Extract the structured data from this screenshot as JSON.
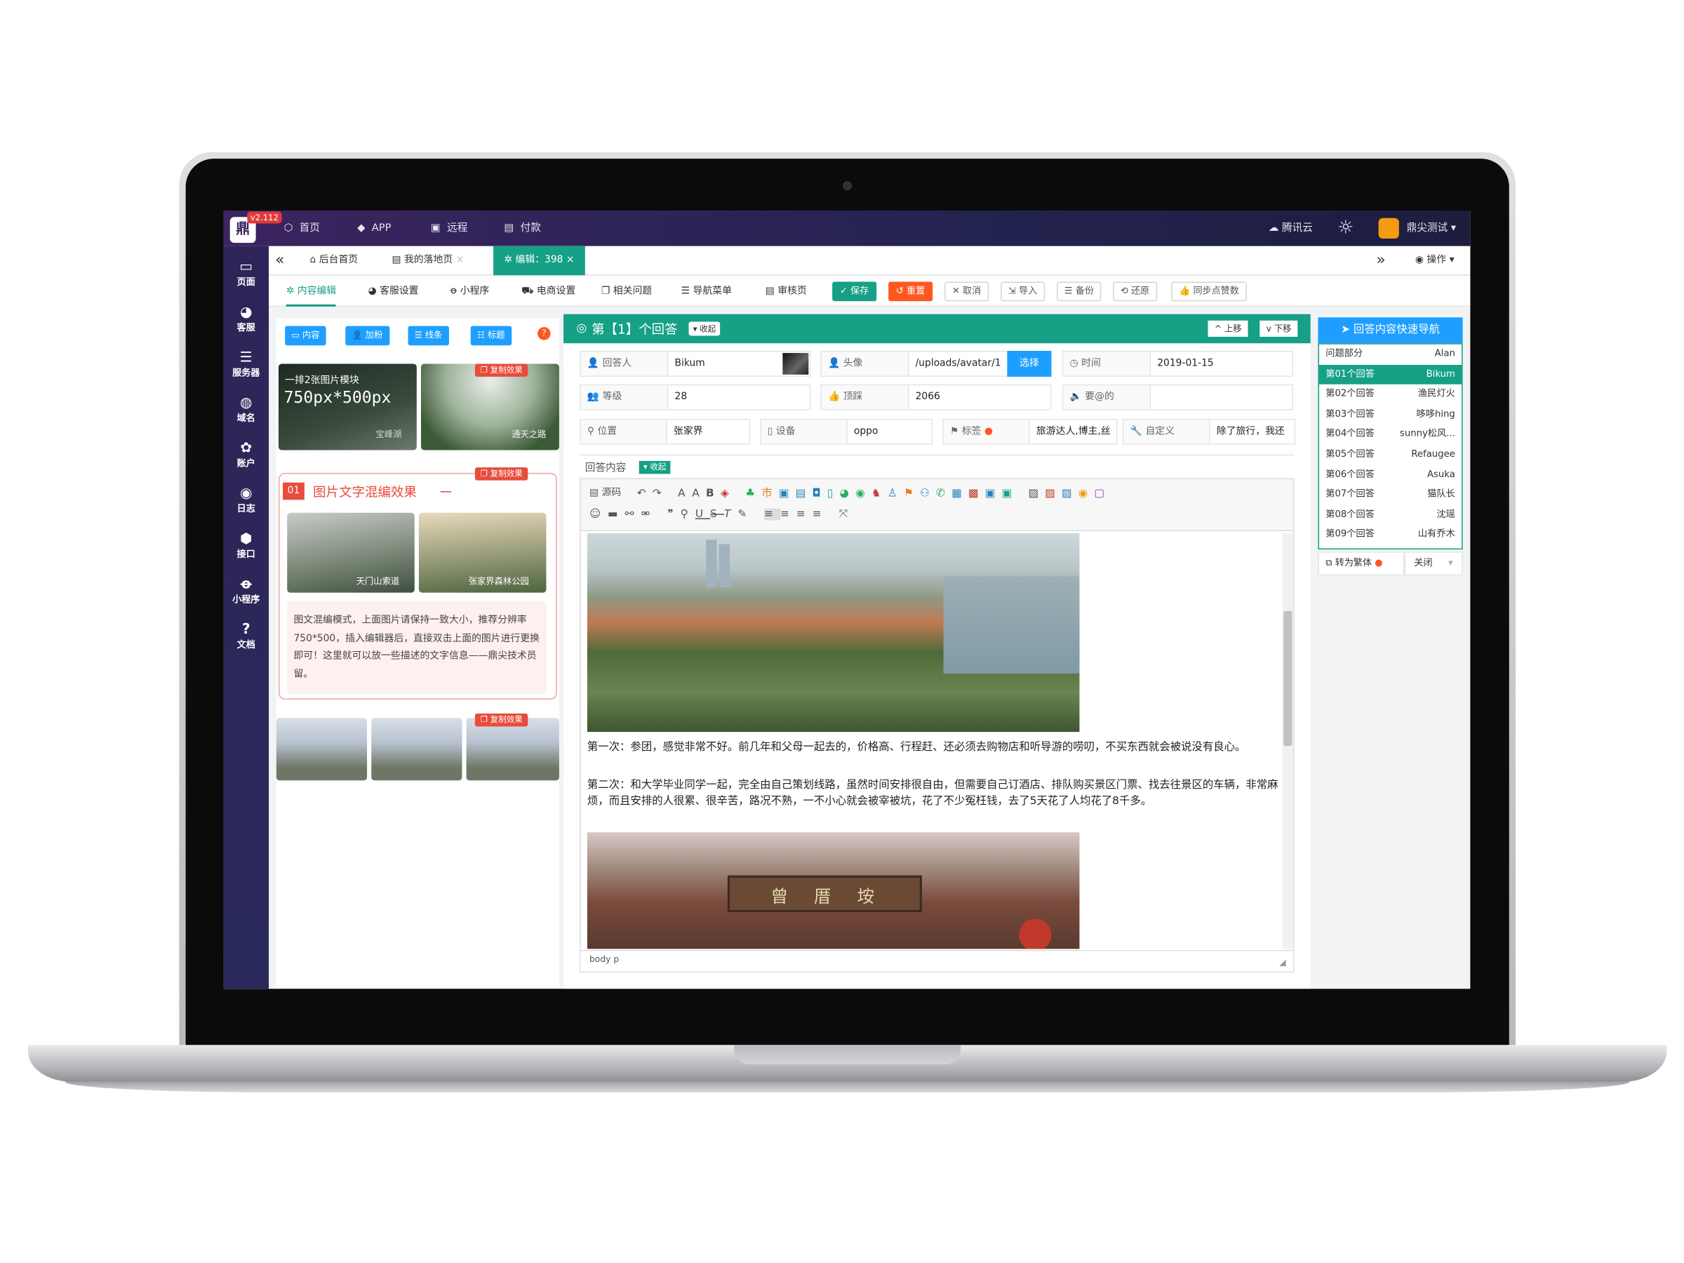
{
  "topbar": {
    "version": "v2.112",
    "nav": [
      "首页",
      "APP",
      "远程",
      "付款"
    ],
    "cloud": "腾讯云",
    "user": "鼎尖测试"
  },
  "sidebar": {
    "items": [
      {
        "label": "页面",
        "icon": "monitor-icon"
      },
      {
        "label": "客服",
        "icon": "headset-icon"
      },
      {
        "label": "服务器",
        "icon": "server-icon"
      },
      {
        "label": "域名",
        "icon": "globe-icon"
      },
      {
        "label": "账户",
        "icon": "paw-icon"
      },
      {
        "label": "日志",
        "icon": "user-log-icon"
      },
      {
        "label": "接口",
        "icon": "api-icon"
      },
      {
        "label": "小程序",
        "icon": "mini-program-icon"
      },
      {
        "label": "文档",
        "icon": "question-icon"
      }
    ]
  },
  "tabs": {
    "back": "«",
    "items": [
      "后台首页",
      "我的落地页",
      "编辑：398"
    ],
    "forward": "»",
    "ops": "操作"
  },
  "toolbar": {
    "tabs": [
      "内容编辑",
      "客服设置",
      "小程序",
      "电商设置",
      "相关问题",
      "导航菜单",
      "审核页"
    ],
    "buttons": [
      "保存",
      "重置",
      "取消",
      "导入",
      "备份",
      "还原",
      "同步点赞数"
    ]
  },
  "left_panel": {
    "buttons": [
      "内容",
      "加粉",
      "线条",
      "标题"
    ],
    "copy_tag": "复制效果",
    "module1_title": "一排2张图片模块",
    "module1_size": "750px*500px",
    "module1_caption1": "宝峰湖",
    "module1_caption2": "通天之路",
    "module2_num": "01",
    "module2_title": "图片文字混编效果",
    "module2_caption1": "天门山索道",
    "module2_caption2": "张家界森林公园",
    "module2_text": "图文混编模式，上面图片请保持一致大小，推荐分辨率750*500，插入编辑器后，直接双击上面的图片进行更换即可！这里就可以放一些描述的文字信息——鼎尖技术员留。"
  },
  "editor": {
    "heading": "第【1】个回答",
    "collapse": "收起",
    "up": "上移",
    "down": "下移",
    "fields": {
      "answerer_label": "回答人",
      "answerer": "Bikum",
      "avatar_label": "头像",
      "avatar": "/uploads/avatar/1",
      "select": "选择",
      "time_label": "时间",
      "time": "2019-01-15",
      "level_label": "等级",
      "level": "28",
      "top_label": "顶踩",
      "top": "2066",
      "mention_label": "要@的",
      "mention": "",
      "location_label": "位置",
      "location": "张家界",
      "device_label": "设备",
      "device": "oppo",
      "tag_label": "标签",
      "tag": "旅游达人,博主,丝",
      "custom_label": "自定义",
      "custom": "除了旅行，我还"
    },
    "content_label": "回答内容",
    "content_collapse": "收起",
    "source": "源码",
    "para1": "第一次：参团，感觉非常不好。前几年和父母一起去的，价格高、行程赶、还必须去购物店和听导游的唠叨，不买东西就会被说没有良心。",
    "para2": "第二次：和大学毕业同学一起，完全由自己策划线路，虽然时间安排很自由，但需要自己订酒店、排队购买景区门票、找去往景区的车辆，非常麻烦，而且安排的人很累、很辛苦，路况不熟，一不小心就会被宰被坑，花了不少冤枉钱，去了5天花了人均花了8千多。",
    "gate_text": "曾厝垵",
    "status": "body  p"
  },
  "quick_nav": {
    "title": "回答内容快速导航",
    "rows": [
      {
        "k": "问题部分",
        "v": "Alan"
      },
      {
        "k": "第01个回答",
        "v": "Bikum"
      },
      {
        "k": "第02个回答",
        "v": "渔民灯火"
      },
      {
        "k": "第03个回答",
        "v": "哆哆hing"
      },
      {
        "k": "第04个回答",
        "v": "sunny松风..."
      },
      {
        "k": "第05个回答",
        "v": "Refaugee"
      },
      {
        "k": "第06个回答",
        "v": "Asuka"
      },
      {
        "k": "第07个回答",
        "v": "猫队长"
      },
      {
        "k": "第08个回答",
        "v": "沈瑶"
      },
      {
        "k": "第09个回答",
        "v": "山有乔木"
      }
    ],
    "convert": "转为繁体",
    "close": "关闭"
  },
  "colors": {
    "accent": "#16a085",
    "danger": "#ff5722",
    "blue": "#1e9fff",
    "red": "#e74c3c"
  }
}
